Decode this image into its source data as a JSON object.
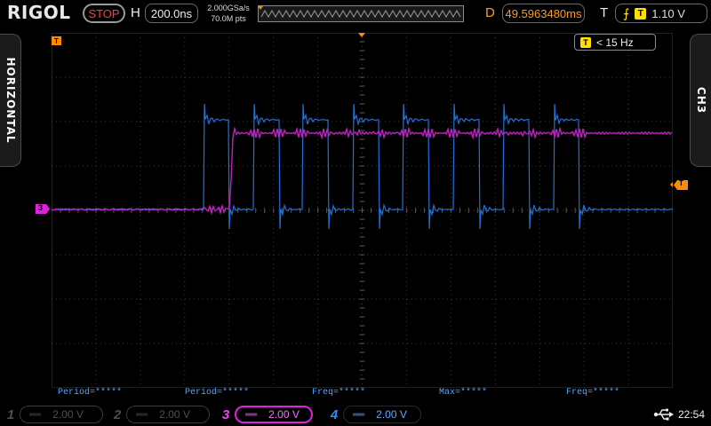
{
  "topbar": {
    "brand": "RIGOL",
    "run_state": "STOP",
    "horizontal_label": "H",
    "timebase": "200.0ns",
    "sample_rate": "2.000GSa/s",
    "memory_depth": "70.0M pts",
    "delay_label": "D",
    "delay_value": "49.5963480ms",
    "trigger_label": "T",
    "trigger_source": "T",
    "trigger_level": "1.10 V"
  },
  "side_tabs": {
    "left": "HORIZONTAL",
    "right": "CH3"
  },
  "screen": {
    "trigger_marker_label": "T",
    "freq_counter": "< 15 Hz",
    "ch3_marker_label": "3",
    "colors": {
      "ch3_magenta": "#c020c0",
      "ch4_blue": "#2070d8",
      "trigger_orange": "#ff8a00",
      "grid": "#3c3c3c"
    }
  },
  "measurements": [
    "Period=*****",
    "Period=*****",
    "Freq=*****",
    "Max=*****",
    "Freq=*****"
  ],
  "channels": [
    {
      "num": "1",
      "coupling": "DC",
      "scale": "2.00 V",
      "state": "off"
    },
    {
      "num": "2",
      "coupling": "DC",
      "scale": "2.00 V",
      "state": "off"
    },
    {
      "num": "3",
      "coupling": "DC",
      "scale": "2.00 V",
      "state": "active"
    },
    {
      "num": "4",
      "coupling": "DC",
      "scale": "2.00 V",
      "state": "on"
    }
  ],
  "status": {
    "usb_icon": "usb-icon",
    "clock": "22:54"
  }
}
